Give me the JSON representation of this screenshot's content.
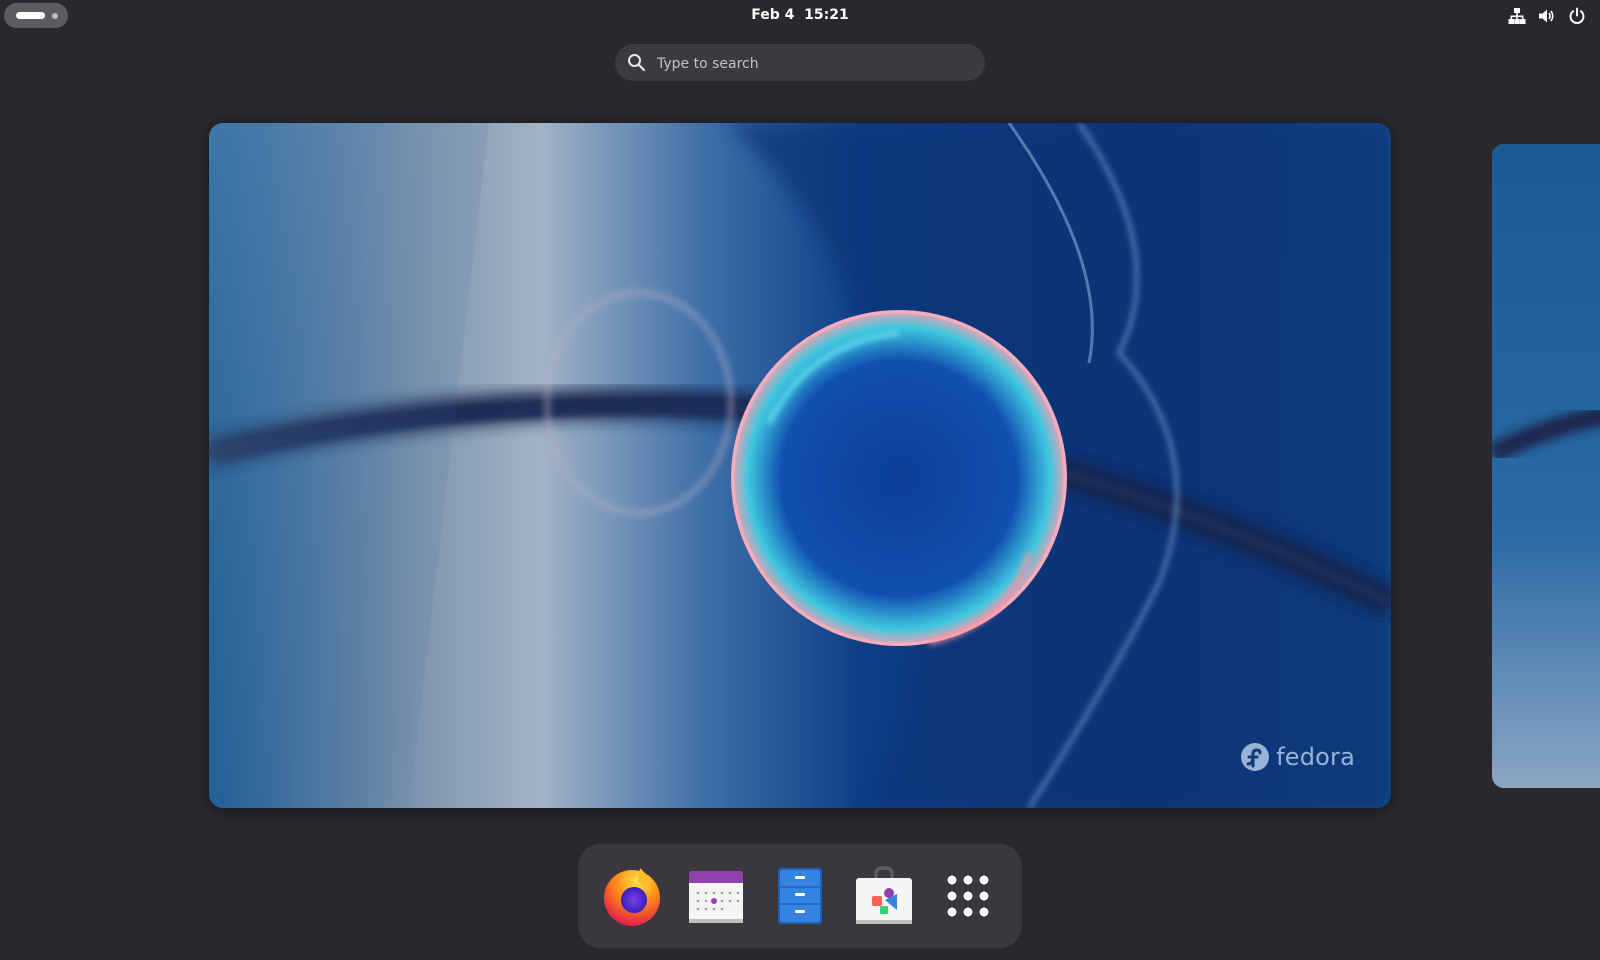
{
  "topbar": {
    "clock": "Feb 4  15:21",
    "tray_icons": [
      "network-wired-icon",
      "volume-icon",
      "power-icon"
    ]
  },
  "search": {
    "placeholder": "Type to search"
  },
  "workspace": {
    "wallpaper_brand": "fedora"
  },
  "dash": {
    "apps": [
      {
        "name": "firefox",
        "icon": "firefox-icon"
      },
      {
        "name": "calendar",
        "icon": "calendar-icon"
      },
      {
        "name": "files",
        "icon": "file-cabinet-icon"
      },
      {
        "name": "software",
        "icon": "software-bag-icon"
      },
      {
        "name": "show-apps",
        "icon": "app-grid-icon"
      }
    ]
  },
  "colors": {
    "topbar_bg": "#2a282d",
    "search_bg": "#3c3a40",
    "dash_bg": "#3a383d",
    "wallpaper_blue": "#0e3a78",
    "fedora_text": "#c8dcf5"
  }
}
